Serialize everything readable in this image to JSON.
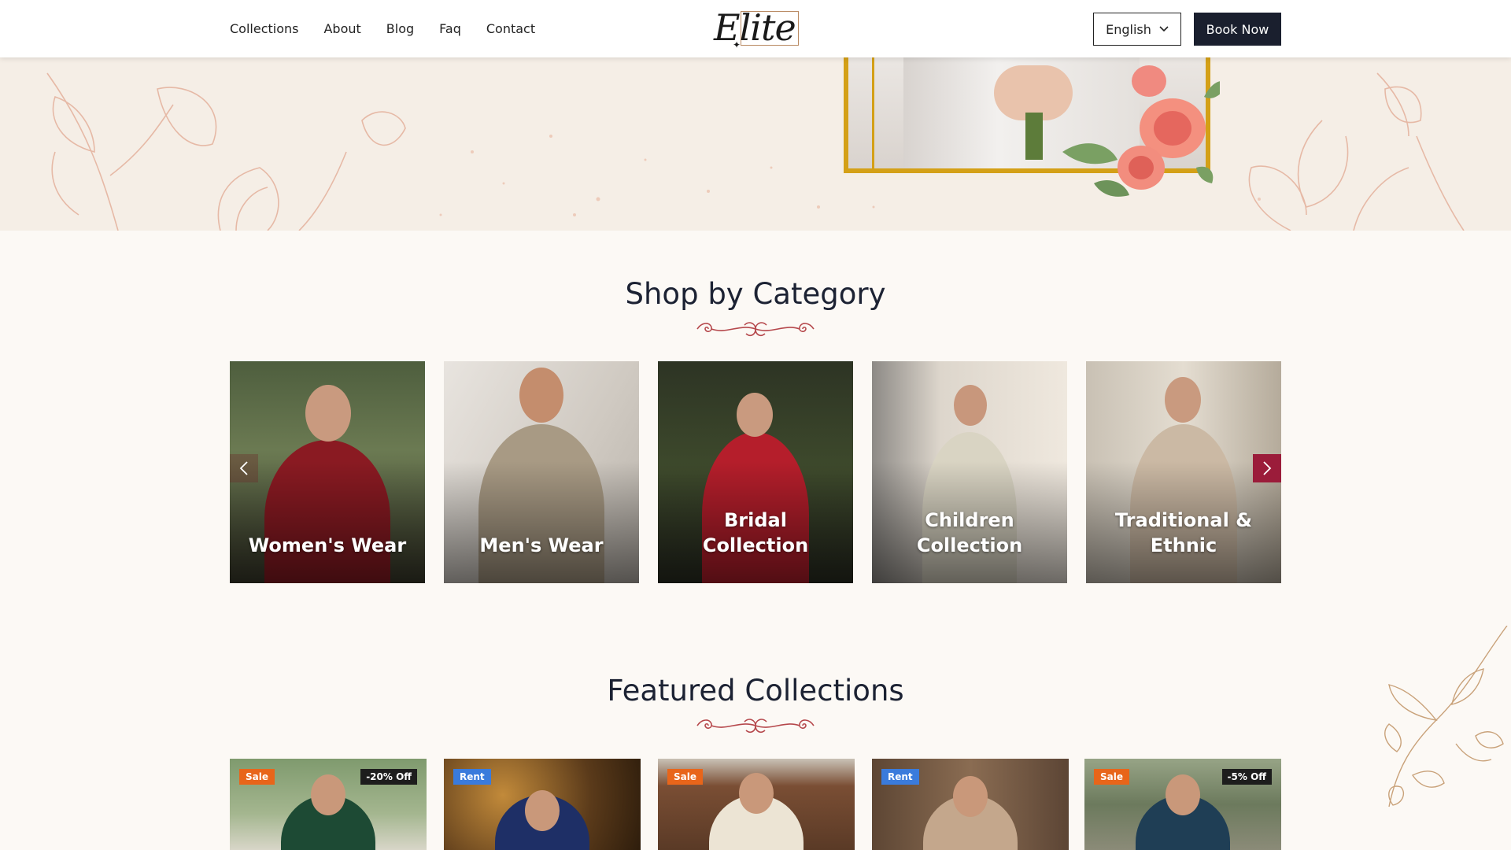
{
  "nav": {
    "links": [
      "Collections",
      "About",
      "Blog",
      "Faq",
      "Contact"
    ],
    "logo_text": "Elite",
    "language": "English",
    "book_label": "Book Now"
  },
  "sections": {
    "shop_by_category": "Shop by Category",
    "featured_collections": "Featured Collections"
  },
  "categories": [
    {
      "label": "Women's Wear"
    },
    {
      "label": "Men's Wear"
    },
    {
      "label": "Bridal Collection"
    },
    {
      "label": "Children Collection"
    },
    {
      "label": "Traditional & Ethnic"
    }
  ],
  "featured": [
    {
      "badge": "Sale",
      "badge_type": "sale",
      "discount": "-20% Off"
    },
    {
      "badge": "Rent",
      "badge_type": "rent",
      "discount": ""
    },
    {
      "badge": "Sale",
      "badge_type": "sale",
      "discount": ""
    },
    {
      "badge": "Rent",
      "badge_type": "rent",
      "discount": ""
    },
    {
      "badge": "Sale",
      "badge_type": "sale",
      "discount": "-5% Off"
    }
  ],
  "icons": {
    "language_chevron": "chevron-down-icon",
    "carousel_prev": "chevron-left-icon",
    "carousel_next": "chevron-right-icon"
  },
  "colors": {
    "accent": "#9b1c3a",
    "dark": "#1a1f2e",
    "gold": "#d4a017",
    "sale": "#e8651a",
    "rent": "#3a7bdc"
  }
}
